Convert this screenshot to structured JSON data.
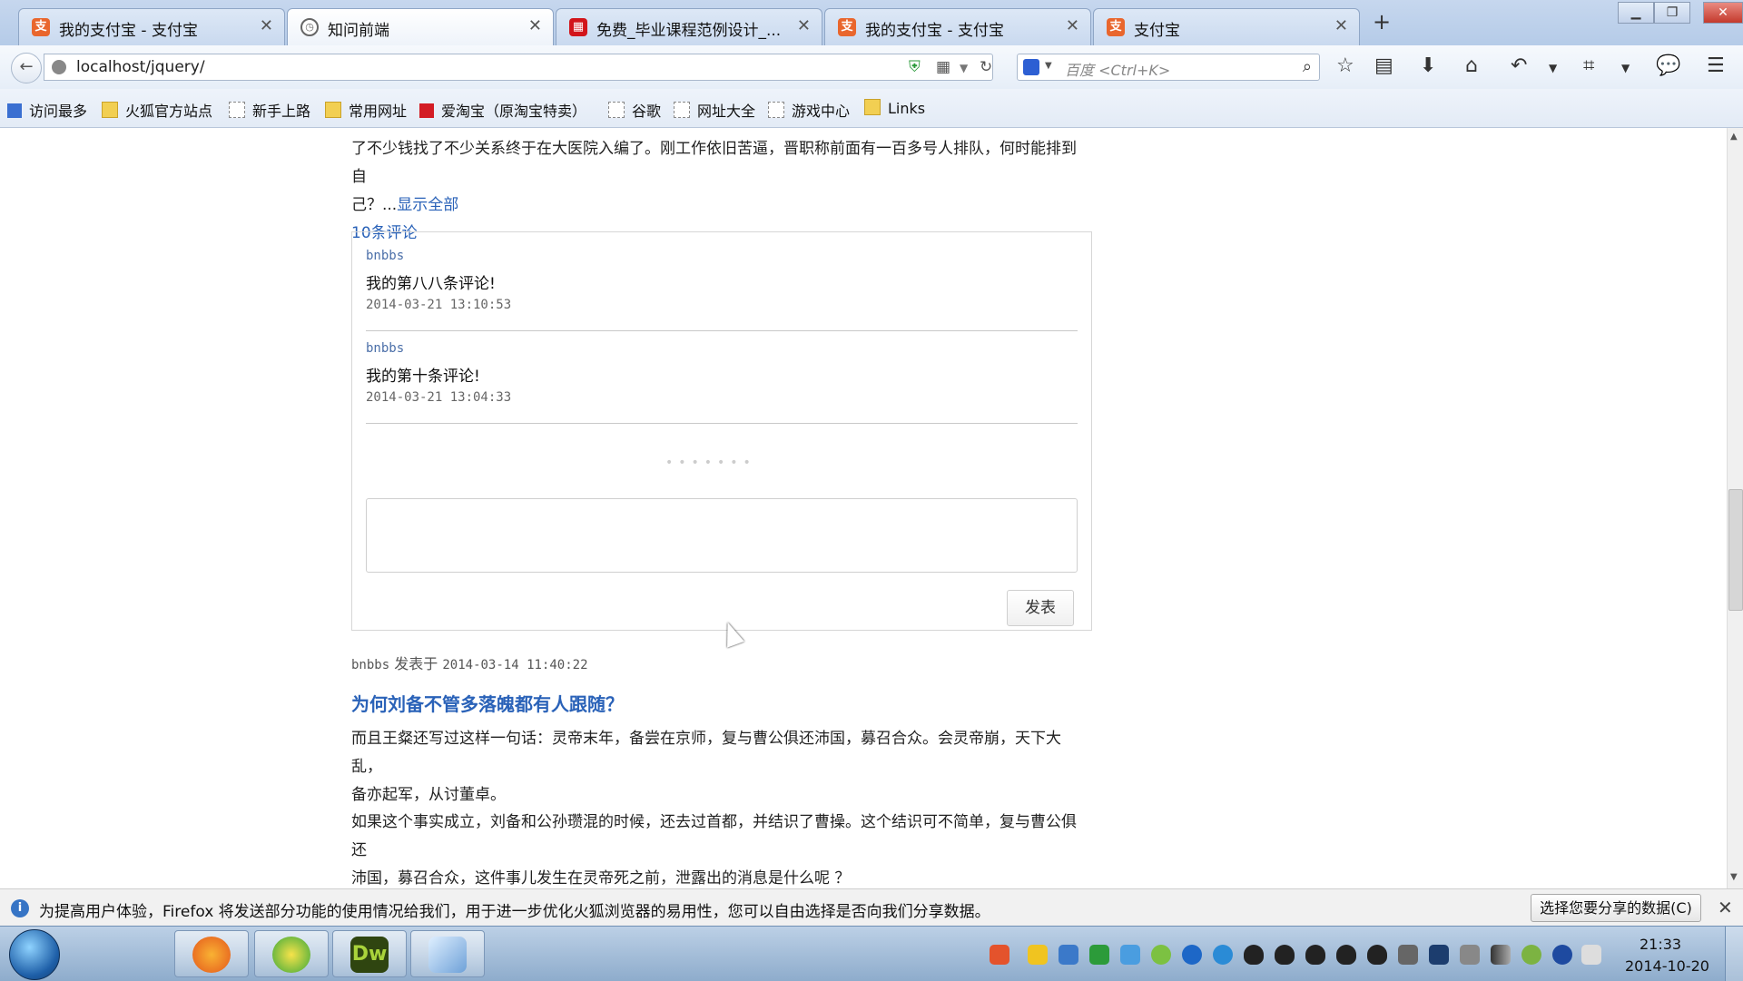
{
  "browser": {
    "tabs": [
      {
        "title": "我的支付宝 - 支付宝",
        "icon": "alipay-icon",
        "active": false
      },
      {
        "title": "知问前端",
        "icon": "clock-icon",
        "active": true
      },
      {
        "title": "免费_毕业课程范例设计_...",
        "icon": "grid-icon",
        "active": false
      },
      {
        "title": "我的支付宝 - 支付宝",
        "icon": "alipay-icon",
        "active": false
      },
      {
        "title": "支付宝",
        "icon": "alipay-icon",
        "active": false
      }
    ],
    "url": "localhost/jquery/",
    "search_placeholder": "百度 <Ctrl+K>"
  },
  "bookmarks": [
    {
      "label": "访问最多",
      "icon": "search-icon"
    },
    {
      "label": "火狐官方站点",
      "icon": "folder-icon"
    },
    {
      "label": "新手上路",
      "icon": "page-icon"
    },
    {
      "label": "常用网址",
      "icon": "folder-icon"
    },
    {
      "label": "爱淘宝（原淘宝特卖）",
      "icon": "taobao-icon"
    },
    {
      "label": "谷歌",
      "icon": "page-icon"
    },
    {
      "label": "网址大全",
      "icon": "page-icon"
    },
    {
      "label": "游戏中心",
      "icon": "page-icon"
    },
    {
      "label": "Links",
      "icon": "folder-icon"
    }
  ],
  "post1": {
    "text_line1": "了不少钱找了不少关系终于在大医院入编了。刚工作依旧苦逼，晋职称前面有一百多号人排队，何时能排到自",
    "text_line2": "己？...",
    "show_all": "显示全部",
    "comment_count": "10条评论"
  },
  "comments": [
    {
      "author": "bnbbs",
      "text": "我的第八八条评论!",
      "time": "2014-03-21 13:10:53"
    },
    {
      "author": "bnbbs",
      "text": "我的第十条评论!",
      "time": "2014-03-21 13:04:33"
    }
  ],
  "pager": "•••••••",
  "post_button": "发表",
  "post2": {
    "author": "bnbbs",
    "posted_label": "发表于",
    "date": "2014-03-14 11:40:22",
    "title": "为何刘备不管多落魄都有人跟随？",
    "para1_line1": "而且王粲还写过这样一句话：灵帝末年，备尝在京师，复与曹公俱还沛国，募召合众。会灵帝崩，天下大乱，",
    "para1_line2": "备亦起军，从讨董卓。",
    "para2_line1": "如果这个事实成立，刘备和公孙瓒混的时候，还去过首都，并结识了曹操。这个结识可不简单，复与曹公俱还",
    "para2_line2": "沛国，募召合众，这件事儿发生在灵帝死之前，泄露出的消息是什么呢 ？"
  },
  "notification": {
    "text": "为提高用户体验，Firefox 将发送部分功能的使用情况给我们，用于进一步优化火狐浏览器的易用性，您可以自由选择是否向我们分享数据。",
    "button": "选择您要分享的数据(C)"
  },
  "taskbar": {
    "apps": [
      {
        "name": "firefox-icon",
        "color": "#e66a1f"
      },
      {
        "name": "app-s-icon",
        "color": "#3aa83a"
      },
      {
        "name": "dreamweaver-icon",
        "color": "#3e5d12",
        "label": "Dw"
      },
      {
        "name": "notepad-icon",
        "color": "#6ea1d8"
      }
    ],
    "time": "21:33",
    "date": "2014-10-20"
  }
}
